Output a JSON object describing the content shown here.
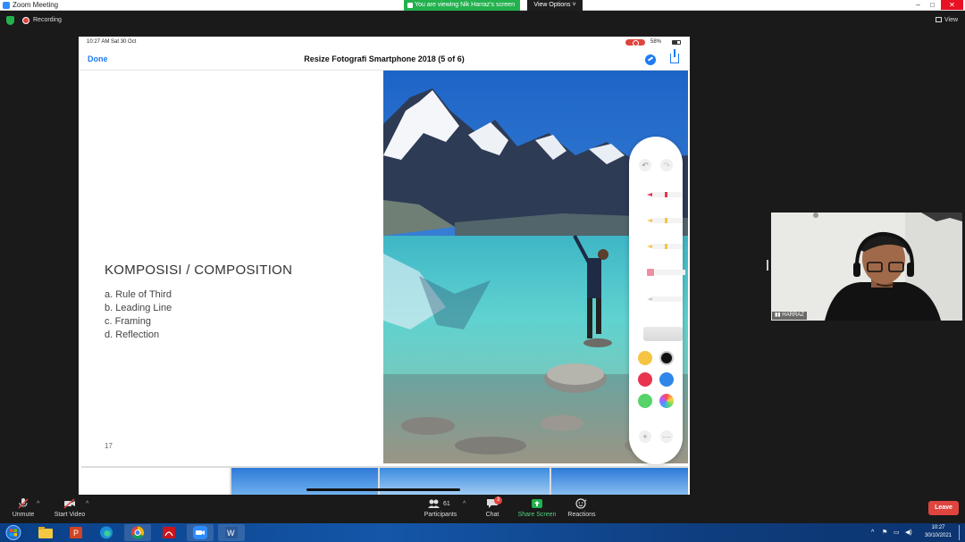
{
  "window": {
    "title": "Zoom Meeting",
    "share_banner": "You are viewing Nik Harraz's screen",
    "view_options": "View Options",
    "min": "–",
    "max": "□",
    "close": "✕"
  },
  "recording": {
    "label": "Recording"
  },
  "view_button": {
    "label": "View"
  },
  "ipad": {
    "time": "10:27 AM  Sat 30 Oct",
    "battery": "58%",
    "done": "Done",
    "doc_title": "Resize Fotografi Smartphone 2018 (5 of 6)"
  },
  "slide": {
    "heading": "KOMPOSISI / COMPOSITION",
    "items": [
      "a. Rule of Third",
      "b. Leading Line",
      "c. Framing",
      "d. Reflection"
    ],
    "page_number": "17"
  },
  "markup": {
    "undo": "↶",
    "redo": "↷",
    "plus": "+",
    "more": "···",
    "colors": [
      "#f5c542",
      "#111111",
      "#e8344e",
      "#2f86ea",
      "#56d46a",
      "rainbow"
    ]
  },
  "participant": {
    "name": "HARRAZ"
  },
  "controls": {
    "unmute": "Unmute",
    "start_video": "Start Video",
    "participants": "Participants",
    "participants_count": "61",
    "chat": "Chat",
    "chat_badge": "3",
    "share_screen": "Share Screen",
    "reactions": "Reactions",
    "leave": "Leave"
  },
  "taskbar": {
    "time": "10:27",
    "date": "30/10/2021"
  }
}
